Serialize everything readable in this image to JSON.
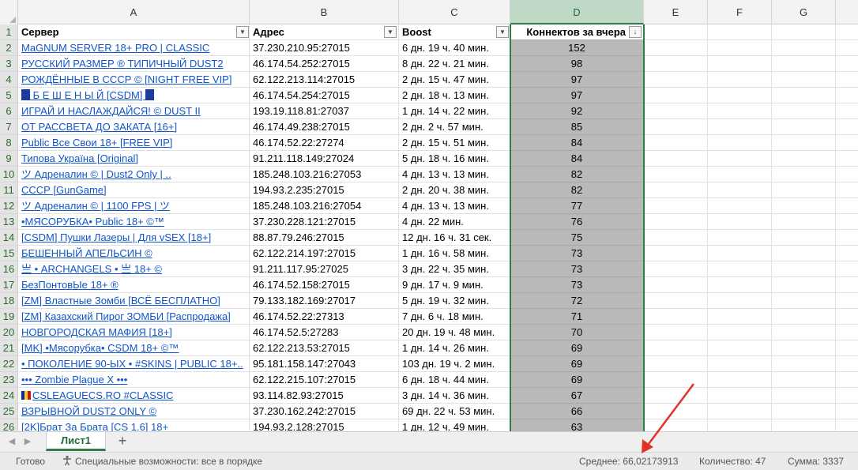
{
  "columns": [
    "A",
    "B",
    "C",
    "D",
    "E",
    "F",
    "G"
  ],
  "headers": {
    "a": "Сервер",
    "b": "Адрес",
    "c": "Boost",
    "d": "Коннектов за вчера"
  },
  "row_numbers": [
    "1",
    "2",
    "3",
    "4",
    "5",
    "6",
    "7",
    "8",
    "9",
    "10",
    "11",
    "12",
    "13",
    "14",
    "15",
    "16",
    "17",
    "18",
    "19",
    "20",
    "21",
    "22",
    "23",
    "24",
    "25",
    "26"
  ],
  "rows": [
    {
      "server": "MaGNUM SERVER 18+ PRO | CLASSIC",
      "address": "37.230.210.95:27015",
      "boost": "6 дн. 19 ч. 40 мин.",
      "connects": "152"
    },
    {
      "server": "РУССКИЙ РАЗМЕР ® ТИПИЧНЫЙ DUST2",
      "address": "46.174.54.252:27015",
      "boost": "8 дн. 22 ч. 21 мин.",
      "connects": "98"
    },
    {
      "server": "РОЖДЁННЫЕ В СССР © [NIGHT FREE VIP]",
      "address": "62.122.213.114:27015",
      "boost": "2 дн. 15 ч. 47 мин.",
      "connects": "97"
    },
    {
      "server": " Б Е Ш Е Н Ы Й  [CSDM] ",
      "address": "46.174.54.254:27015",
      "boost": "2 дн. 18 ч. 13 мин.",
      "connects": "97"
    },
    {
      "server": "ИГРАЙ И НАСЛАЖДАЙСЯ! © DUST II",
      "address": "193.19.118.81:27037",
      "boost": "1 дн. 14 ч. 22 мин.",
      "connects": "92"
    },
    {
      "server": "ОТ РАССВЕТА ДО ЗАКАТА [16+]",
      "address": "46.174.49.238:27015",
      "boost": "2 дн. 2 ч. 57 мин.",
      "connects": "85"
    },
    {
      "server": "Public Все Свои 18+ [FREE VIP]",
      "address": "46.174.52.22:27274",
      "boost": "2 дн. 15 ч. 51 мин.",
      "connects": "84"
    },
    {
      "server": "Типова Україна [Original]",
      "address": "91.211.118.149:27024",
      "boost": "5 дн. 18 ч. 16 мин.",
      "connects": "84"
    },
    {
      "server": "ツ  Адреналин © | Dust2 Only | ..",
      "address": "185.248.103.216:27053",
      "boost": "4 дн. 13 ч. 13 мин.",
      "connects": "82"
    },
    {
      "server": "СССР [GunGame]",
      "address": "194.93.2.235:27015",
      "boost": "2 дн. 20 ч. 38 мин.",
      "connects": "82"
    },
    {
      "server": "ツ  Адреналин © | 1100 FPS |  ツ",
      "address": "185.248.103.216:27054",
      "boost": "4 дн. 13 ч. 13 мин.",
      "connects": "77"
    },
    {
      "server": "•МЯСОРУБКА• Public 18+ ©™",
      "address": "37.230.228.121:27015",
      "boost": "4 дн. 22 мин.",
      "connects": "76"
    },
    {
      "server": "[CSDM] Пушки Лазеры | Для vSEX [18+]",
      "address": "88.87.79.246:27015",
      "boost": "12 дн. 16 ч. 31 сек.",
      "connects": "75"
    },
    {
      "server": "БЕШЕННЫЙ АПЕЛЬСИН ©",
      "address": "62.122.214.197:27015",
      "boost": "1 дн. 16 ч. 58 мин.",
      "connects": "73"
    },
    {
      "server": "亗 • ARCHANGELS • 亗 18+ ©",
      "address": "91.211.117.95:27025",
      "boost": "3 дн. 22 ч. 35 мин.",
      "connects": "73"
    },
    {
      "server": "БезПонтовЫе 18+ ®",
      "address": "46.174.52.158:27015",
      "boost": "9 дн. 17 ч. 9 мин.",
      "connects": "73"
    },
    {
      "server": "[ZM] Властные Зомби [ВСЁ БЕСПЛАТНО]",
      "address": "79.133.182.169:27017",
      "boost": "5 дн. 19 ч. 32 мин.",
      "connects": "72"
    },
    {
      "server": "[ZM] Казахский Пирог ЗОМБИ [Распродажа]",
      "address": "46.174.52.22:27313",
      "boost": "7 дн. 6 ч. 18 мин.",
      "connects": "71"
    },
    {
      "server": "НОВГОРОДСКАЯ МАФИЯ [18+]",
      "address": "46.174.52.5:27283",
      "boost": "20 дн. 19 ч. 48 мин.",
      "connects": "70"
    },
    {
      "server": "[MK] •Мясорубка• CSDM 18+ ©™",
      "address": "62.122.213.53:27015",
      "boost": "1 дн. 14 ч. 26 мин.",
      "connects": "69"
    },
    {
      "server": "• ПОКОЛЕНИЕ 90-ЫХ • #SKINS | PUBLIC 18+..",
      "address": "95.181.158.147:27043",
      "boost": "103 дн. 19 ч. 2 мин.",
      "connects": "69"
    },
    {
      "server": "••• Zombie Plague X •••",
      "address": "62.122.215.107:27015",
      "boost": "6 дн. 18 ч. 44 мин.",
      "connects": "69"
    },
    {
      "server": "CSLEAGUECS.RO #CLASSIC",
      "address": "93.114.82.93:27015",
      "boost": "3 дн. 14 ч. 36 мин.",
      "connects": "67"
    },
    {
      "server": "ВЗРЫВНОЙ DUST2 ONLY ©",
      "address": "37.230.162.242:27015",
      "boost": "69 дн. 22 ч. 53 мин.",
      "connects": "66"
    },
    {
      "server": "[2K]Брат За Брата [CS 1.6] 18+",
      "address": "194.93.2.128:27015",
      "boost": "1 дн. 12 ч. 49 мин.",
      "connects": "63"
    }
  ],
  "tabs": {
    "sheet_name": "Лист1",
    "add_label": "+"
  },
  "status": {
    "ready": "Готово",
    "accessibility": "Специальные возможности: все в порядке",
    "average": "Среднее: 66,02173913",
    "count": "Количество: 47",
    "sum": "Сумма: 3337"
  },
  "colors": {
    "accent_green": "#2e7d46",
    "selection_gray": "#b9b9b9",
    "link_blue": "#1155cc",
    "arrow_red": "#e0322b"
  }
}
